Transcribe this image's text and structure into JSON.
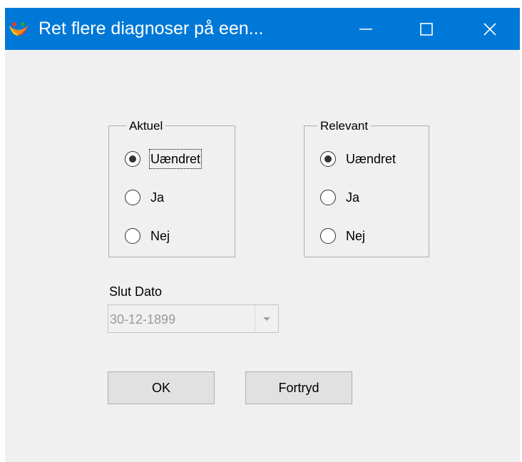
{
  "window": {
    "title": "Ret flere diagnoser på een...",
    "controls": {
      "minimize_icon": "minimize-icon",
      "maximize_icon": "maximize-icon",
      "close_icon": "close-icon"
    }
  },
  "groups": [
    {
      "legend": "Aktuel",
      "options": [
        {
          "label": "Uændret",
          "checked": true,
          "focused": true
        },
        {
          "label": "Ja",
          "checked": false
        },
        {
          "label": "Nej",
          "checked": false
        }
      ]
    },
    {
      "legend": "Relevant",
      "options": [
        {
          "label": "Uændret",
          "checked": true
        },
        {
          "label": "Ja",
          "checked": false
        },
        {
          "label": "Nej",
          "checked": false
        }
      ]
    }
  ],
  "slut_dato": {
    "label": "Slut Dato",
    "value": "30-12-1899",
    "enabled": false
  },
  "buttons": {
    "ok": "OK",
    "cancel": "Fortryd"
  },
  "colors": {
    "titlebar": "#0078d7",
    "dialog_bg": "#f0f0f0",
    "disabled_text": "#9a9a9a"
  }
}
